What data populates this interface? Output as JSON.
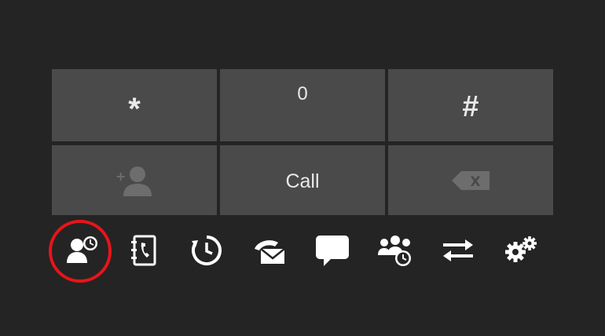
{
  "keypad": {
    "keys": [
      {
        "label": "*"
      },
      {
        "label": "0"
      },
      {
        "label": "#"
      },
      {
        "label": ""
      },
      {
        "label": "Call"
      },
      {
        "label": ""
      }
    ],
    "add_contact_icon": "add-contact-icon",
    "backspace_icon": "backspace-icon",
    "backspace_glyph": "X"
  },
  "toolbar": {
    "items": [
      {
        "icon": "presence-status-icon",
        "highlighted": true
      },
      {
        "icon": "phonebook-icon"
      },
      {
        "icon": "call-history-icon"
      },
      {
        "icon": "voicemail-icon"
      },
      {
        "icon": "chat-icon"
      },
      {
        "icon": "conference-icon"
      },
      {
        "icon": "transfer-icon"
      },
      {
        "icon": "settings-icon"
      }
    ]
  },
  "colors": {
    "background": "#242424",
    "key": "#4a4a4a",
    "text": "#e9e9e9",
    "highlight": "#e8141a"
  }
}
